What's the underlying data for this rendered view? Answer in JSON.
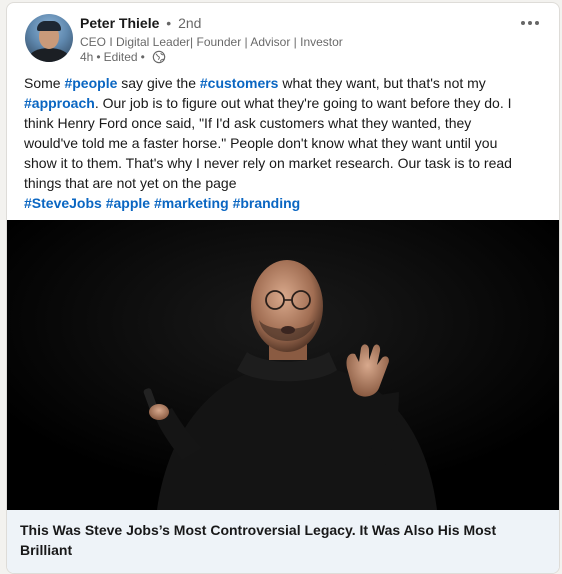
{
  "post": {
    "author": {
      "name": "Peter Thiele",
      "degree": "2nd",
      "headline": "CEO I Digital Leader| Founder | Advisor | Investor",
      "timestamp": "4h",
      "edited": "Edited",
      "visibility_icon": "globe-icon"
    },
    "more_icon": "more-options-icon",
    "text_lines": [
      [
        {
          "t": "Some "
        },
        {
          "t": "#people",
          "tag": true
        },
        {
          "t": " say give the "
        },
        {
          "t": "#customers",
          "tag": true
        },
        {
          "t": " what they want, but that's not my"
        }
      ],
      [
        {
          "t": "#approach",
          "tag": true
        },
        {
          "t": ". Our job is to figure out what they're going to want before they do. I"
        }
      ],
      [
        {
          "t": "think Henry Ford once said, \"If I'd ask customers what they wanted, they"
        }
      ],
      [
        {
          "t": "would've told me a faster horse.\" People don't know what they want until you"
        }
      ],
      [
        {
          "t": "show it to them. That's why I never rely on market research. Our task is to read"
        }
      ],
      [
        {
          "t": "things that are not yet on the page"
        }
      ],
      [
        {
          "t": "#SteveJobs",
          "tag": true
        },
        {
          "t": " "
        },
        {
          "t": "#apple",
          "tag": true
        },
        {
          "t": " "
        },
        {
          "t": "#marketing",
          "tag": true
        },
        {
          "t": " "
        },
        {
          "t": "#branding",
          "tag": true
        }
      ]
    ],
    "link_preview": {
      "title": "This Was Steve Jobs’s Most Controversial Legacy. It Was Also His Most Brilliant"
    }
  },
  "colors": {
    "hashtag": "#0a66c2",
    "page_bg": "#f3f2ef",
    "caption_bg": "#eef3f8"
  }
}
